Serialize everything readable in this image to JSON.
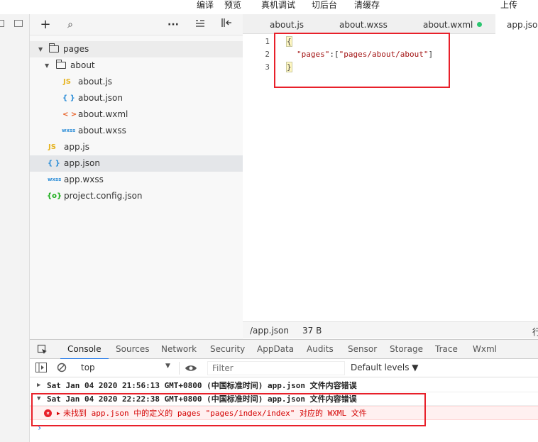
{
  "top_toolbar": {
    "compile": "编译",
    "preview": "预览",
    "real_device_debug": "真机调试",
    "background": "切后台",
    "clear_cache": "清缓存",
    "upload": "上传"
  },
  "tree_toolbar": {
    "add": "+",
    "search": "⌕",
    "more": "···"
  },
  "file_tree": {
    "pages_folder": "pages",
    "about_folder": "about",
    "about_js": "about.js",
    "about_json": "about.json",
    "about_wxml": "about.wxml",
    "about_wxss": "about.wxss",
    "app_js": "app.js",
    "app_json": "app.json",
    "app_wxss": "app.wxss",
    "project_config": "project.config.json",
    "icons": {
      "js": "JS",
      "json": "{ }",
      "wxml": "< >",
      "wxss": "wxss",
      "config": "{o}"
    }
  },
  "editor_tabs": [
    "about.js",
    "about.wxss",
    "about.wxml",
    "app.json"
  ],
  "editor": {
    "line_numbers": [
      "1",
      "2",
      "3"
    ],
    "line1": "{",
    "line2_key": "\"pages\"",
    "line2_sep": ":[",
    "line2_val": "\"pages/about/about\"",
    "line2_end": "]",
    "line3": "}"
  },
  "status": {
    "path": "/app.json",
    "size": "37 B",
    "right": "行"
  },
  "devtools_tabs": [
    "Console",
    "Sources",
    "Network",
    "Security",
    "AppData",
    "Audits",
    "Sensor",
    "Storage",
    "Trace",
    "Wxml"
  ],
  "console_bar": {
    "context": "top",
    "filter_placeholder": "Filter",
    "levels": "Default levels ▼"
  },
  "console": {
    "log1": "Sat Jan 04 2020 21:56:13 GMT+0800 (中国标准时间)  app.json 文件内容错误",
    "log2": "Sat Jan 04 2020 22:22:38 GMT+0800 (中国标准时间)  app.json 文件内容错误",
    "error": "未找到 app.json 中的定义的 pages \"pages/index/index\" 对应的 WXML 文件"
  },
  "colors": {
    "highlight_red": "#e8202a",
    "modified_dot": "#2bc670",
    "error_text": "#d40000"
  }
}
